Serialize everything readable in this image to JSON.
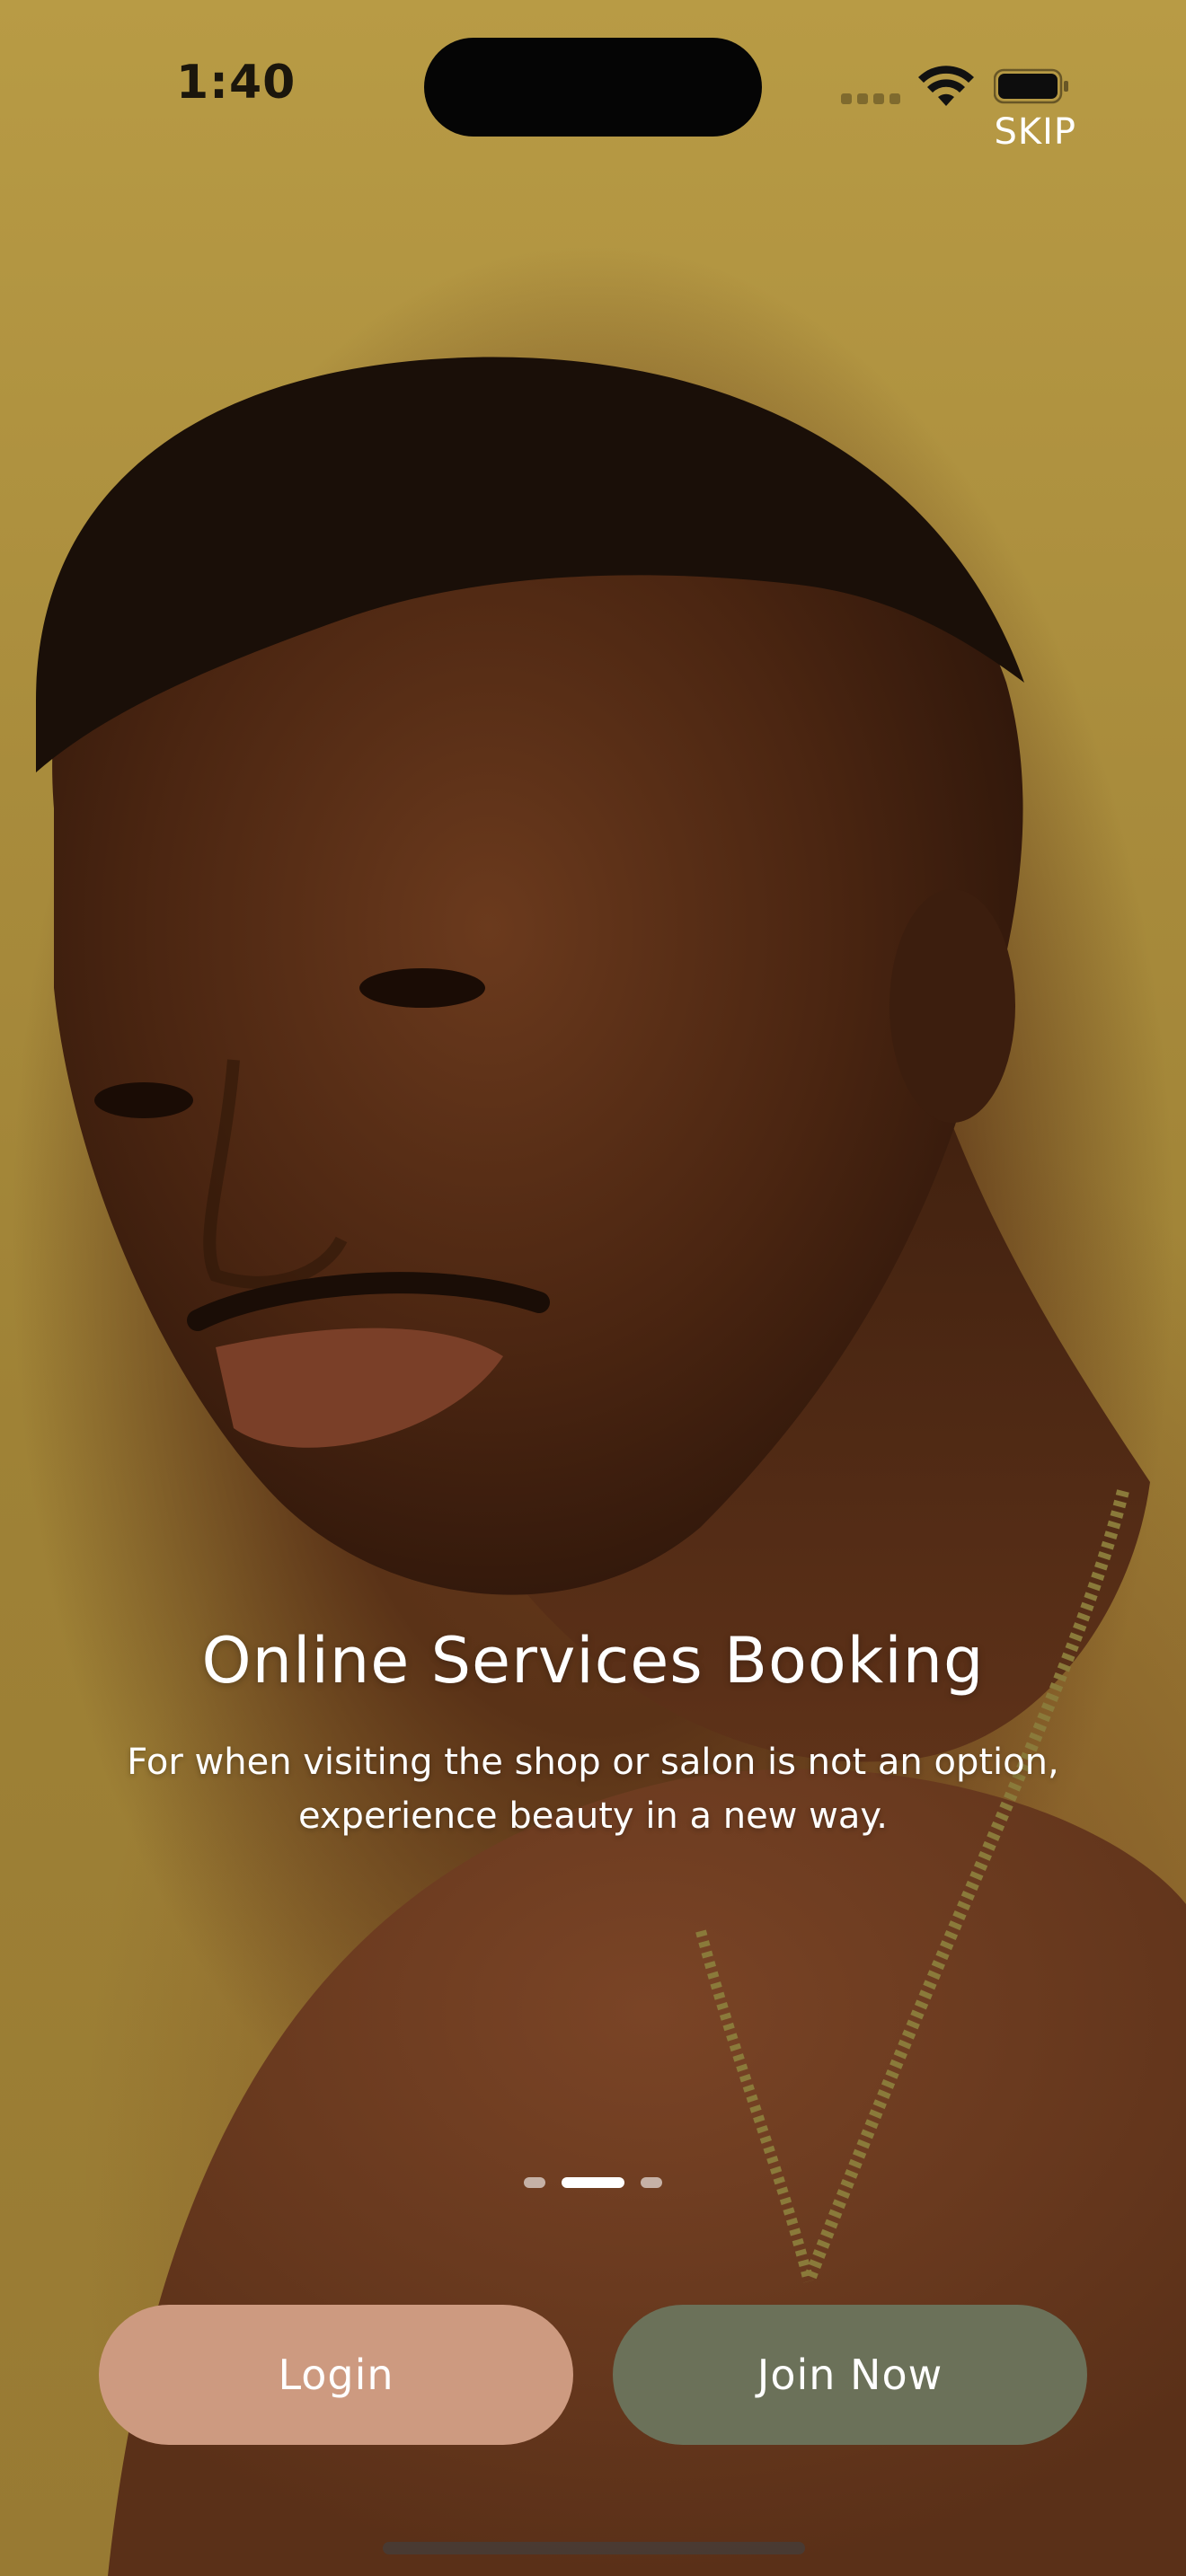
{
  "status_bar": {
    "time": "1:40"
  },
  "header": {
    "skip_label": "SKIP"
  },
  "onboarding": {
    "title": "Online Services Booking",
    "description": "For when visiting the shop or salon is not an option, experience beauty in a new way.",
    "pager": {
      "total_pages": 3,
      "current_page": 2
    }
  },
  "actions": {
    "login_label": "Login",
    "join_label": "Join Now"
  },
  "colors": {
    "login_button": "#cd9a80",
    "join_button": "#6b7159",
    "background": "#a98c3c"
  },
  "icons": {
    "signal": "cellular-signal-icon",
    "wifi": "wifi-icon",
    "battery": "battery-icon"
  }
}
